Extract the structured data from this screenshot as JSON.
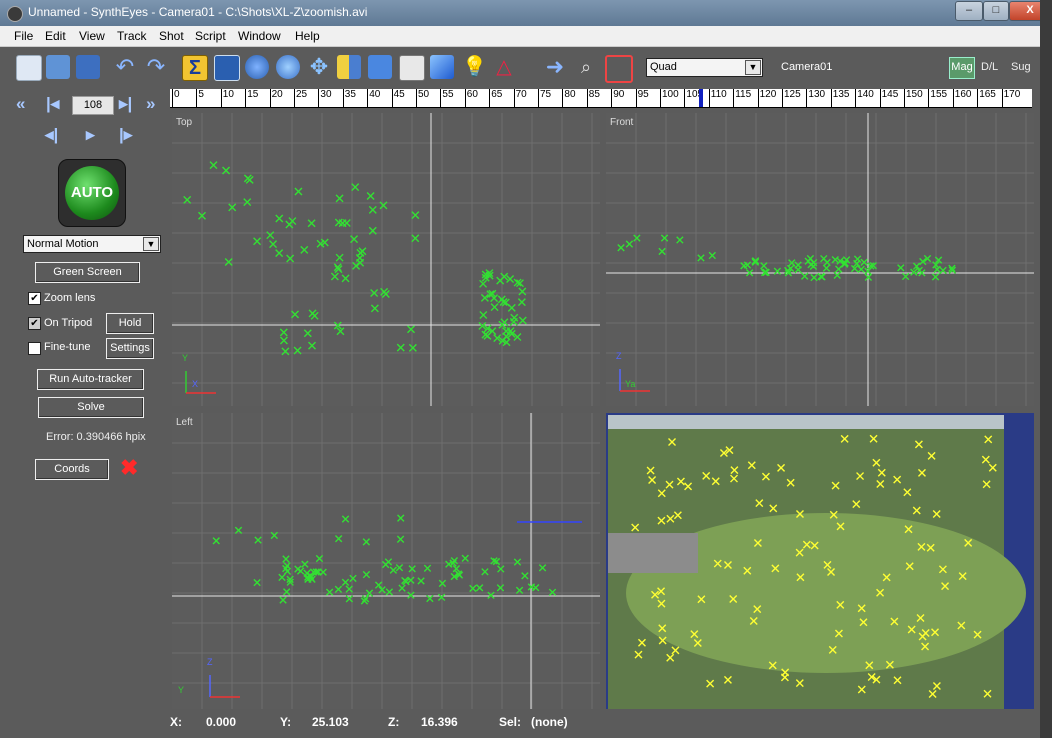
{
  "window": {
    "title": "Unnamed - SynthEyes - Camera01 - C:\\Shots\\XL-Z\\zoomish.avi"
  },
  "window_controls": {
    "minimize": "–",
    "maximize": "□",
    "close": "X"
  },
  "menu": [
    "File",
    "Edit",
    "View",
    "Track",
    "Shot",
    "Script",
    "Window",
    "Help"
  ],
  "toolbar": {
    "icons": [
      "new-file-icon",
      "open-file-icon",
      "save-icon",
      "undo-icon",
      "redo-icon",
      "sigma-icon",
      "camera-view-icon",
      "gear-icon",
      "cluster-icon",
      "move-icon",
      "lens-icon",
      "calculator-icon",
      "graph-icon",
      "cube-icon",
      "light-icon",
      "perspective-icon",
      "arrow-right-icon",
      "zoom-icon",
      "fit-icon"
    ],
    "layout": "Quad",
    "camera": "Camera01",
    "mag": "Mag",
    "dl": "D/L",
    "sug": "Sug"
  },
  "playback": {
    "frame": "108"
  },
  "sidebar": {
    "auto": "AUTO",
    "motion": "Normal Motion",
    "green_screen": "Green Screen",
    "zoom_lens": "Zoom lens",
    "on_tripod": "On Tripod",
    "hold": "Hold",
    "fine_tune": "Fine-tune",
    "settings": "Settings",
    "run_autotracker": "Run Auto-tracker",
    "solve": "Solve",
    "error": "Error: 0.390466 hpix",
    "coords": "Coords"
  },
  "ruler": {
    "ticks": [
      "0",
      "5",
      "10",
      "15",
      "20",
      "25",
      "30",
      "35",
      "40",
      "45",
      "50",
      "55",
      "60",
      "65",
      "70",
      "75",
      "80",
      "85",
      "90",
      "95",
      "100",
      "105",
      "110",
      "115",
      "120",
      "125",
      "130",
      "135",
      "140",
      "145",
      "150",
      "155",
      "160",
      "165",
      "170"
    ],
    "current_frame": 108
  },
  "viewports": {
    "top": {
      "label": "Top",
      "axis1": "Y",
      "axis2": "X"
    },
    "front": {
      "label": "Front",
      "axis1": "Z",
      "axis2": "Ya"
    },
    "left": {
      "label": "Left",
      "axis1": "Z",
      "axis2": "Y"
    }
  },
  "status": {
    "x_label": "X:",
    "x_value": "0.000",
    "y_label": "Y:",
    "y_value": "25.103",
    "z_label": "Z:",
    "z_value": "16.396",
    "sel_label": "Sel:",
    "sel_value": "(none)"
  },
  "colors": {
    "tracker_green": "#33e033",
    "tracker_yellow": "#ffff33",
    "panel_gray": "#5b5b5b"
  }
}
